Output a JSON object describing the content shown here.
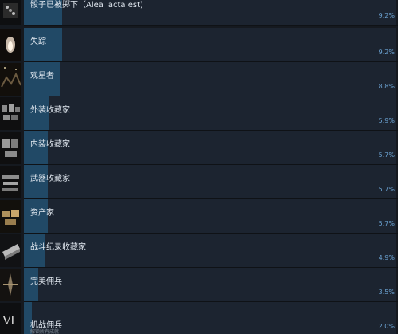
{
  "achievements": [
    {
      "name": "骰子已被掷下（Alea iacta est)",
      "percent_text": "9.2%",
      "percent": 9.2,
      "icon": "dice-icon",
      "fill_width_ratio": 0.1
    },
    {
      "name": "失踪",
      "percent_text": "9.2%",
      "percent": 9.2,
      "icon": "ghost-figure-icon"
    },
    {
      "name": "观星者",
      "percent_text": "8.8%",
      "percent": 8.8,
      "icon": "stargazer-icon"
    },
    {
      "name": "外装收藏家",
      "percent_text": "5.9%",
      "percent": 5.9,
      "icon": "outfit-collector-icon"
    },
    {
      "name": "内装收藏家",
      "percent_text": "5.7%",
      "percent": 5.7,
      "icon": "interior-collector-icon"
    },
    {
      "name": "武器收藏家",
      "percent_text": "5.7%",
      "percent": 5.7,
      "icon": "weapon-collector-icon"
    },
    {
      "name": "资产家",
      "percent_text": "5.7%",
      "percent": 5.7,
      "icon": "capitalist-icon"
    },
    {
      "name": "战斗纪录收藏家",
      "percent_text": "4.9%",
      "percent": 4.9,
      "icon": "battle-record-icon"
    },
    {
      "name": "完美佣兵",
      "percent_text": "3.5%",
      "percent": 3.5,
      "icon": "perfect-mercenary-icon"
    },
    {
      "name": "机战佣兵",
      "percent_text": "2.0%",
      "percent": 2.0,
      "icon": "roman-six-icon",
      "icon_text": "VI",
      "subtext": "解锁所有成就"
    }
  ]
}
